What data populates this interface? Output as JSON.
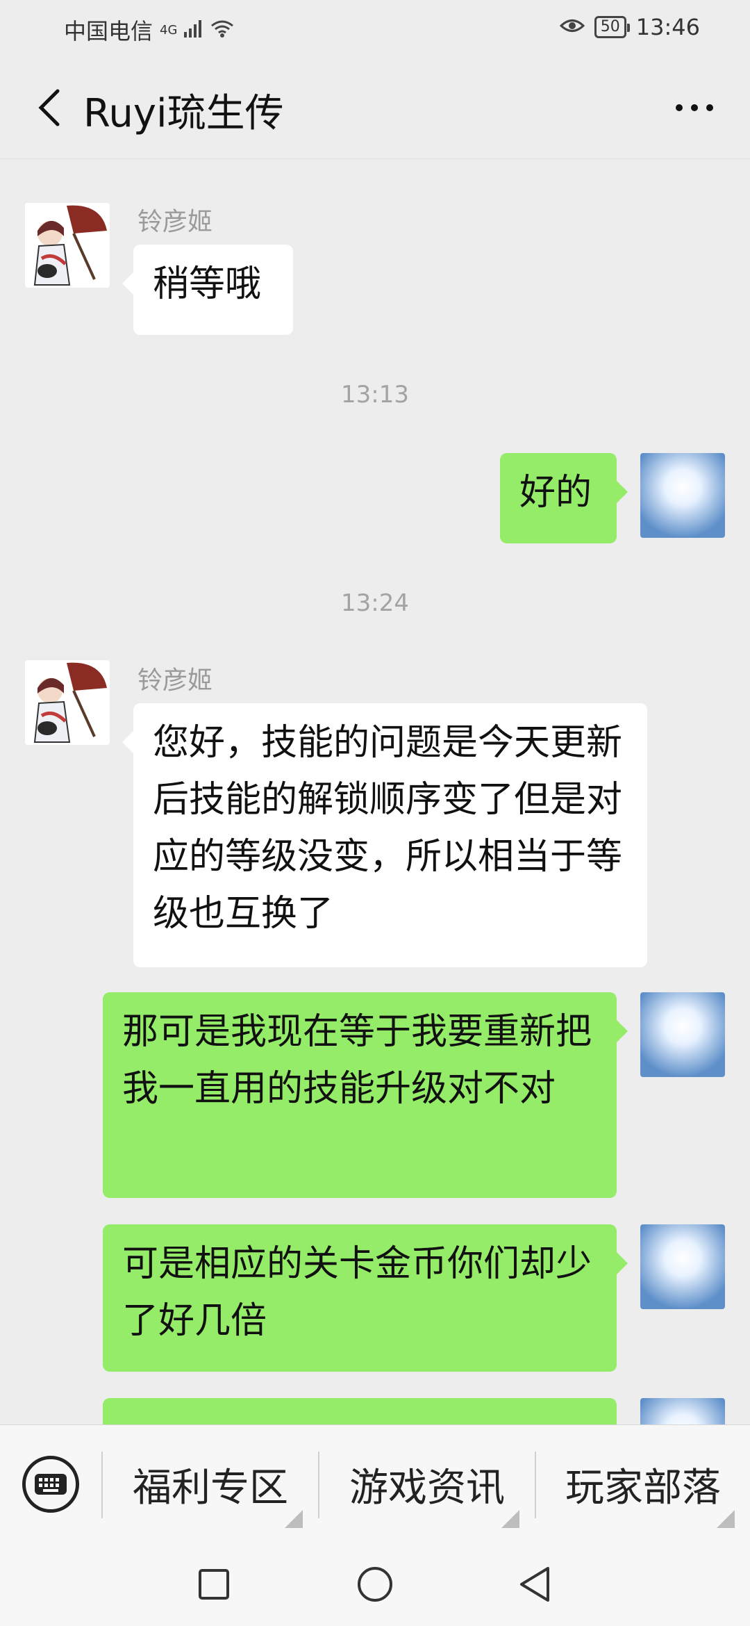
{
  "status_bar": {
    "carrier": "中国电信",
    "network": "4G",
    "battery": "50",
    "time": "13:46"
  },
  "header": {
    "title": "Ruyi琉生传"
  },
  "messages": [
    {
      "type": "received",
      "sender": "铃彦姬",
      "text": "稍等哦"
    },
    {
      "type": "time",
      "text": "13:13"
    },
    {
      "type": "sent",
      "text": "好的"
    },
    {
      "type": "time",
      "text": "13:24"
    },
    {
      "type": "received",
      "sender": "铃彦姬",
      "text": "您好，技能的问题是今天更新后技能的解锁顺序变了但是对应的等级没变，所以相当于等级也互换了"
    },
    {
      "type": "sent",
      "text": "那可是我现在等于我要重新把我一直用的技能升级对不对"
    },
    {
      "type": "sent",
      "text": "可是相应的关卡金币你们却少了好几倍"
    }
  ],
  "menu": {
    "items": [
      "福利专区",
      "游戏资讯",
      "玩家部落"
    ]
  },
  "colors": {
    "sent_bubble": "#95ec69",
    "received_bubble": "#ffffff",
    "background": "#ededed"
  }
}
